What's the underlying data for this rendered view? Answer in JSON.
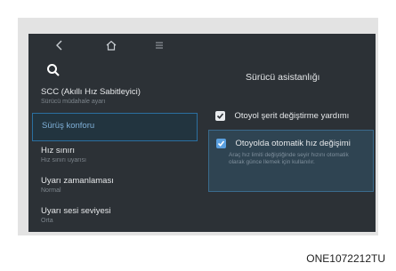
{
  "topbar": {
    "back_icon": "chevron-left-icon",
    "home_icon": "home-icon",
    "menu_icon": "menu-icon"
  },
  "search": {
    "icon": "search-icon"
  },
  "settings_list": [
    {
      "title": "SCC (Akıllı Hız Sabitleyici)",
      "subtitle": "Sürücü müdahale ayarı"
    },
    {
      "title": "Sürüş konforu",
      "subtitle": ""
    },
    {
      "title": "Hız sınırı",
      "subtitle": "Hız sınırı uyarısı"
    },
    {
      "title": "Uyarı zamanlaması",
      "subtitle": "Normal"
    },
    {
      "title": "Uyarı sesi seviyesi",
      "subtitle": "Orta"
    }
  ],
  "panel": {
    "title": "Sürücü asistanlığı",
    "options": [
      {
        "label": "Otoyol şerit değiştirme yardımı",
        "checked": true
      },
      {
        "label": "Otoyolda otomatik hız değişimi",
        "checked": true,
        "description": "Araç hız limiti değiştiğinde seyir hızını otomatik olarak günce llemek için kullanılır."
      }
    ]
  },
  "caption": "ONE1072212TU"
}
